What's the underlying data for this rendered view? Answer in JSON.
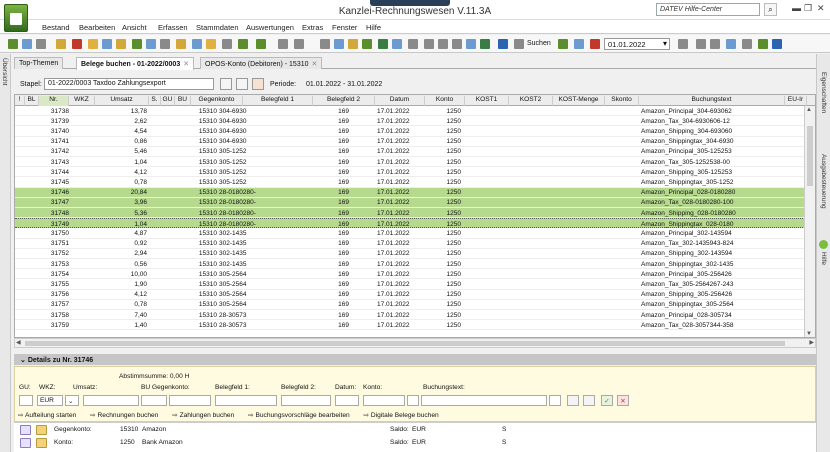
{
  "app": {
    "title": "Kanzlei-Rechnungswesen V.11.3A",
    "help_search_placeholder": "DATEV Hilfe-Center"
  },
  "menu": [
    "Bestand",
    "Bearbeiten",
    "Ansicht",
    "Erfassen",
    "Stammdaten",
    "Auswertungen",
    "Extras",
    "Fenster",
    "Hilfe"
  ],
  "toolbar": {
    "search_label": "Suchen",
    "date": "01.01.2022"
  },
  "side": {
    "left_label": "Übersicht",
    "right_labels": [
      "Eigenschaften",
      "Ausgabesteuerung",
      "Hilfe"
    ]
  },
  "tabs": [
    {
      "label": "Top-Themen",
      "active": false,
      "close": ""
    },
    {
      "label": "Belege buchen - 01-2022/0003",
      "active": true,
      "close": "✕"
    },
    {
      "label": "OPOS-Konto (Debitoren) - 15310",
      "active": false,
      "close": "✕"
    }
  ],
  "stapel": {
    "label": "Stapel:",
    "value": "01-2022/0003   Taxdoo Zahlungsexport",
    "periode_label": "Periode:",
    "periode": "01.01.2022 - 31.01.2022"
  },
  "grid": {
    "columns": [
      "!",
      "BL",
      "Nr.",
      "WKZ",
      "Umsatz",
      "S.",
      "GU",
      "BU",
      "Gegenkonto",
      "Belegfeld 1",
      "Belegfeld 2",
      "Datum",
      "Konto",
      "KOST1",
      "KOST2",
      "KOST-Menge",
      "Skonto",
      "Buchungstext",
      "EU-Ir"
    ],
    "rows": [
      {
        "nr": "31738",
        "umsatz": "13,78",
        "gegenkonto": "15310",
        "beleg1": "304-6930",
        "beleg2": "169",
        "datum": "17.01.2022",
        "konto": "1250",
        "text": "Amazon_Principal_304-693062",
        "state": ""
      },
      {
        "nr": "31739",
        "umsatz": "2,62",
        "gegenkonto": "15310",
        "beleg1": "304-6930",
        "beleg2": "169",
        "datum": "17.01.2022",
        "konto": "1250",
        "text": "Amazon_Tax_304-6930606-12",
        "state": ""
      },
      {
        "nr": "31740",
        "umsatz": "4,54",
        "gegenkonto": "15310",
        "beleg1": "304-6930",
        "beleg2": "169",
        "datum": "17.01.2022",
        "konto": "1250",
        "text": "Amazon_Shipping_304-693060",
        "state": ""
      },
      {
        "nr": "31741",
        "umsatz": "0,86",
        "gegenkonto": "15310",
        "beleg1": "304-6930",
        "beleg2": "169",
        "datum": "17.01.2022",
        "konto": "1250",
        "text": "Amazon_Shippingtax_304-6930",
        "state": ""
      },
      {
        "nr": "31742",
        "umsatz": "5,46",
        "gegenkonto": "15310",
        "beleg1": "305-1252",
        "beleg2": "169",
        "datum": "17.01.2022",
        "konto": "1250",
        "text": "Amazon_Principal_305-125253",
        "state": ""
      },
      {
        "nr": "31743",
        "umsatz": "1,04",
        "gegenkonto": "15310",
        "beleg1": "305-1252",
        "beleg2": "169",
        "datum": "17.01.2022",
        "konto": "1250",
        "text": "Amazon_Tax_305-1252538-00",
        "state": ""
      },
      {
        "nr": "31744",
        "umsatz": "4,12",
        "gegenkonto": "15310",
        "beleg1": "305-1252",
        "beleg2": "169",
        "datum": "17.01.2022",
        "konto": "1250",
        "text": "Amazon_Shipping_305-125253",
        "state": ""
      },
      {
        "nr": "31745",
        "umsatz": "0,78",
        "gegenkonto": "15310",
        "beleg1": "305-1252",
        "beleg2": "169",
        "datum": "17.01.2022",
        "konto": "1250",
        "text": "Amazon_Shippingtax_305-1252",
        "state": ""
      },
      {
        "nr": "31746",
        "umsatz": "20,84",
        "gegenkonto": "15310",
        "beleg1": "28-0180280-",
        "beleg2": "169",
        "datum": "17.01.2022",
        "konto": "1250",
        "text": "Amazon_Principal_028-0180280",
        "state": "sel"
      },
      {
        "nr": "31747",
        "umsatz": "3,96",
        "gegenkonto": "15310",
        "beleg1": "28-0180280-",
        "beleg2": "169",
        "datum": "17.01.2022",
        "konto": "1250",
        "text": "Amazon_Tax_028-0180280-100",
        "state": "sel"
      },
      {
        "nr": "31748",
        "umsatz": "5,36",
        "gegenkonto": "15310",
        "beleg1": "28-0180280-",
        "beleg2": "169",
        "datum": "17.01.2022",
        "konto": "1250",
        "text": "Amazon_Shipping_028-0180280",
        "state": "sel"
      },
      {
        "nr": "31749",
        "umsatz": "1,04",
        "gegenkonto": "15310",
        "beleg1": "28-0180280-",
        "beleg2": "169",
        "datum": "17.01.2022",
        "konto": "1250",
        "text": "Amazon_Shippingtax_028-0180",
        "state": "cur"
      },
      {
        "nr": "31750",
        "umsatz": "4,87",
        "gegenkonto": "15310",
        "beleg1": "302-1435",
        "beleg2": "169",
        "datum": "17.01.2022",
        "konto": "1250",
        "text": "Amazon_Principal_302-143594",
        "state": ""
      },
      {
        "nr": "31751",
        "umsatz": "0,92",
        "gegenkonto": "15310",
        "beleg1": "302-1435",
        "beleg2": "169",
        "datum": "17.01.2022",
        "konto": "1250",
        "text": "Amazon_Tax_302-1435943-824",
        "state": ""
      },
      {
        "nr": "31752",
        "umsatz": "2,94",
        "gegenkonto": "15310",
        "beleg1": "302-1435",
        "beleg2": "169",
        "datum": "17.01.2022",
        "konto": "1250",
        "text": "Amazon_Shipping_302-143594",
        "state": ""
      },
      {
        "nr": "31753",
        "umsatz": "0,56",
        "gegenkonto": "15310",
        "beleg1": "302-1435",
        "beleg2": "169",
        "datum": "17.01.2022",
        "konto": "1250",
        "text": "Amazon_Shippingtax_302-1435",
        "state": ""
      },
      {
        "nr": "31754",
        "umsatz": "10,00",
        "gegenkonto": "15310",
        "beleg1": "305-2564",
        "beleg2": "169",
        "datum": "17.01.2022",
        "konto": "1250",
        "text": "Amazon_Principal_305-256426",
        "state": ""
      },
      {
        "nr": "31755",
        "umsatz": "1,90",
        "gegenkonto": "15310",
        "beleg1": "305-2564",
        "beleg2": "169",
        "datum": "17.01.2022",
        "konto": "1250",
        "text": "Amazon_Tax_305-2564267-243",
        "state": ""
      },
      {
        "nr": "31756",
        "umsatz": "4,12",
        "gegenkonto": "15310",
        "beleg1": "305-2564",
        "beleg2": "169",
        "datum": "17.01.2022",
        "konto": "1250",
        "text": "Amazon_Shipping_305-256426",
        "state": ""
      },
      {
        "nr": "31757",
        "umsatz": "0,78",
        "gegenkonto": "15310",
        "beleg1": "305-2564",
        "beleg2": "169",
        "datum": "17.01.2022",
        "konto": "1250",
        "text": "Amazon_Shippingtax_305-2564",
        "state": ""
      },
      {
        "nr": "31758",
        "umsatz": "7,40",
        "gegenkonto": "15310",
        "beleg1": "28-30573",
        "beleg2": "169",
        "datum": "17.01.2022",
        "konto": "1250",
        "text": "Amazon_Principal_028-305734",
        "state": ""
      },
      {
        "nr": "31759",
        "umsatz": "1,40",
        "gegenkonto": "15310",
        "beleg1": "28-30573",
        "beleg2": "169",
        "datum": "17.01.2022",
        "konto": "1250",
        "text": "Amazon_Tax_028-3057344-358",
        "state": ""
      }
    ]
  },
  "details": {
    "header": "Details zu Nr. 31746",
    "abstimmsumme": "Abstimmsumme: 0,00 H",
    "labels": {
      "gu": "GU:",
      "wkz": "WKZ:",
      "umsatz": "Umsatz:",
      "bu_gegenkonto": "BU Gegenkonto:",
      "beleg1": "Belegfeld 1:",
      "beleg2": "Belegfeld 2:",
      "datum": "Datum:",
      "konto": "Konto:",
      "buchungstext": "Buchungstext:"
    },
    "wkz_value": "EUR",
    "links": [
      "Aufteilung starten",
      "Rechnungen buchen",
      "Zahlungen buchen",
      "Buchungsvorschläge bearbeiten",
      "Digitale Belege buchen"
    ]
  },
  "footer": {
    "gegenkonto_label": "Gegenkonto:",
    "gegenkonto_nr": "15310",
    "gegenkonto_name": "Amazon",
    "konto_label": "Konto:",
    "konto_nr": "1250",
    "konto_name": "Bank Amazon",
    "saldo_label": "Saldo:",
    "currency": "EUR",
    "s": "S"
  }
}
